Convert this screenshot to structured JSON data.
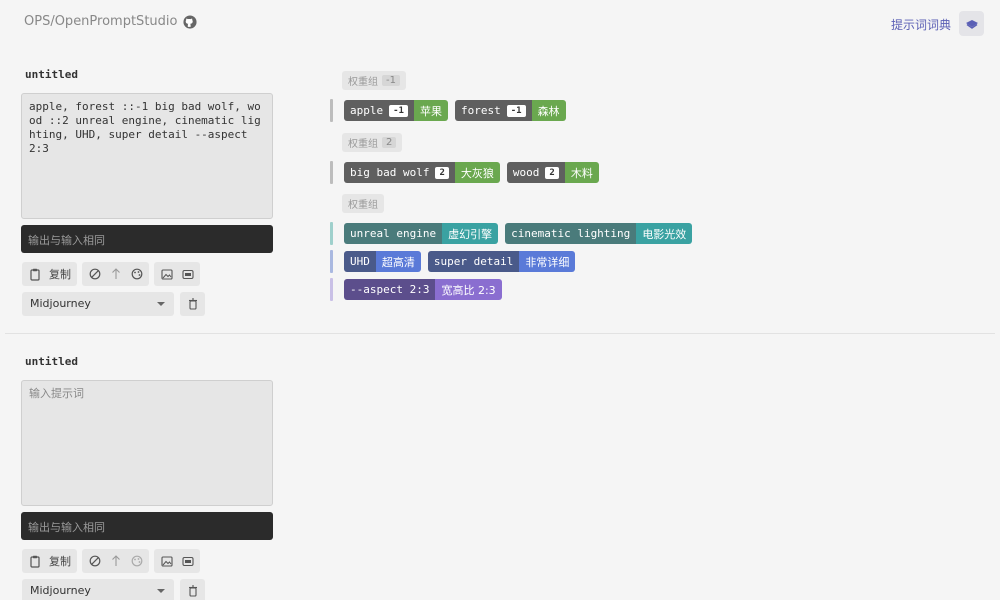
{
  "header": {
    "brand": "OPS/OpenPromptStudio",
    "dict_link": "提示词词典"
  },
  "sections": [
    {
      "title": "untitled",
      "prompt": "apple, forest ::-1 big bad wolf, wood ::2 unreal engine, cinematic lighting, UHD, super detail --aspect 2:3",
      "output_placeholder": "输出与输入相同",
      "copy_label": "复制",
      "model": "Midjourney"
    },
    {
      "title": "untitled",
      "prompt_placeholder": "输入提示词",
      "output_placeholder": "输出与输入相同",
      "copy_label": "复制",
      "model": "Midjourney"
    }
  ],
  "groups": [
    {
      "label": "权重组",
      "weight": "-1"
    },
    {
      "label": "权重组",
      "weight": "2"
    },
    {
      "label": "权重组"
    }
  ],
  "tokens": {
    "row1": [
      {
        "en": "apple",
        "weight": "-1",
        "zh": "苹果"
      },
      {
        "en": "forest",
        "weight": "-1",
        "zh": "森林"
      }
    ],
    "row2": [
      {
        "en": "big bad wolf",
        "weight": "2",
        "zh": "大灰狼"
      },
      {
        "en": "wood",
        "weight": "2",
        "zh": "木料"
      }
    ],
    "row3": [
      {
        "en": "unreal engine",
        "zh": "虚幻引擎"
      },
      {
        "en": "cinematic lighting",
        "zh": "电影光效"
      }
    ],
    "row4": [
      {
        "en": "UHD",
        "zh": "超高清"
      },
      {
        "en": "super detail",
        "zh": "非常详细"
      }
    ],
    "row5": [
      {
        "en": "--aspect 2:3",
        "zh": "宽高比 2:3"
      }
    ]
  },
  "colors": {
    "token_dark": "#5f5f5f",
    "green": "#6aa84f",
    "teal_dark": "#4a7b7b",
    "teal": "#3aa2a2",
    "blue_dark": "#4a5a8a",
    "blue": "#5a7ad8",
    "purple_dark": "#5c4e8c",
    "purple": "#8a6ed0",
    "accent": "#5a5fb5"
  }
}
